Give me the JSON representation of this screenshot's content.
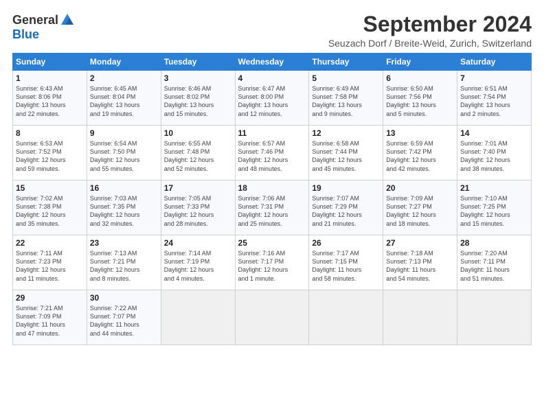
{
  "logo": {
    "general": "General",
    "blue": "Blue"
  },
  "title": "September 2024",
  "location": "Seuzach Dorf / Breite-Weid, Zurich, Switzerland",
  "days_header": [
    "Sunday",
    "Monday",
    "Tuesday",
    "Wednesday",
    "Thursday",
    "Friday",
    "Saturday"
  ],
  "weeks": [
    [
      {
        "day": "1",
        "lines": [
          "Sunrise: 6:43 AM",
          "Sunset: 8:06 PM",
          "Daylight: 13 hours",
          "and 22 minutes."
        ]
      },
      {
        "day": "2",
        "lines": [
          "Sunrise: 6:45 AM",
          "Sunset: 8:04 PM",
          "Daylight: 13 hours",
          "and 19 minutes."
        ]
      },
      {
        "day": "3",
        "lines": [
          "Sunrise: 6:46 AM",
          "Sunset: 8:02 PM",
          "Daylight: 13 hours",
          "and 15 minutes."
        ]
      },
      {
        "day": "4",
        "lines": [
          "Sunrise: 6:47 AM",
          "Sunset: 8:00 PM",
          "Daylight: 13 hours",
          "and 12 minutes."
        ]
      },
      {
        "day": "5",
        "lines": [
          "Sunrise: 6:49 AM",
          "Sunset: 7:58 PM",
          "Daylight: 13 hours",
          "and 9 minutes."
        ]
      },
      {
        "day": "6",
        "lines": [
          "Sunrise: 6:50 AM",
          "Sunset: 7:56 PM",
          "Daylight: 13 hours",
          "and 5 minutes."
        ]
      },
      {
        "day": "7",
        "lines": [
          "Sunrise: 6:51 AM",
          "Sunset: 7:54 PM",
          "Daylight: 13 hours",
          "and 2 minutes."
        ]
      }
    ],
    [
      {
        "day": "8",
        "lines": [
          "Sunrise: 6:53 AM",
          "Sunset: 7:52 PM",
          "Daylight: 12 hours",
          "and 59 minutes."
        ]
      },
      {
        "day": "9",
        "lines": [
          "Sunrise: 6:54 AM",
          "Sunset: 7:50 PM",
          "Daylight: 12 hours",
          "and 55 minutes."
        ]
      },
      {
        "day": "10",
        "lines": [
          "Sunrise: 6:55 AM",
          "Sunset: 7:48 PM",
          "Daylight: 12 hours",
          "and 52 minutes."
        ]
      },
      {
        "day": "11",
        "lines": [
          "Sunrise: 6:57 AM",
          "Sunset: 7:46 PM",
          "Daylight: 12 hours",
          "and 48 minutes."
        ]
      },
      {
        "day": "12",
        "lines": [
          "Sunrise: 6:58 AM",
          "Sunset: 7:44 PM",
          "Daylight: 12 hours",
          "and 45 minutes."
        ]
      },
      {
        "day": "13",
        "lines": [
          "Sunrise: 6:59 AM",
          "Sunset: 7:42 PM",
          "Daylight: 12 hours",
          "and 42 minutes."
        ]
      },
      {
        "day": "14",
        "lines": [
          "Sunrise: 7:01 AM",
          "Sunset: 7:40 PM",
          "Daylight: 12 hours",
          "and 38 minutes."
        ]
      }
    ],
    [
      {
        "day": "15",
        "lines": [
          "Sunrise: 7:02 AM",
          "Sunset: 7:38 PM",
          "Daylight: 12 hours",
          "and 35 minutes."
        ]
      },
      {
        "day": "16",
        "lines": [
          "Sunrise: 7:03 AM",
          "Sunset: 7:35 PM",
          "Daylight: 12 hours",
          "and 32 minutes."
        ]
      },
      {
        "day": "17",
        "lines": [
          "Sunrise: 7:05 AM",
          "Sunset: 7:33 PM",
          "Daylight: 12 hours",
          "and 28 minutes."
        ]
      },
      {
        "day": "18",
        "lines": [
          "Sunrise: 7:06 AM",
          "Sunset: 7:31 PM",
          "Daylight: 12 hours",
          "and 25 minutes."
        ]
      },
      {
        "day": "19",
        "lines": [
          "Sunrise: 7:07 AM",
          "Sunset: 7:29 PM",
          "Daylight: 12 hours",
          "and 21 minutes."
        ]
      },
      {
        "day": "20",
        "lines": [
          "Sunrise: 7:09 AM",
          "Sunset: 7:27 PM",
          "Daylight: 12 hours",
          "and 18 minutes."
        ]
      },
      {
        "day": "21",
        "lines": [
          "Sunrise: 7:10 AM",
          "Sunset: 7:25 PM",
          "Daylight: 12 hours",
          "and 15 minutes."
        ]
      }
    ],
    [
      {
        "day": "22",
        "lines": [
          "Sunrise: 7:11 AM",
          "Sunset: 7:23 PM",
          "Daylight: 12 hours",
          "and 11 minutes."
        ]
      },
      {
        "day": "23",
        "lines": [
          "Sunrise: 7:13 AM",
          "Sunset: 7:21 PM",
          "Daylight: 12 hours",
          "and 8 minutes."
        ]
      },
      {
        "day": "24",
        "lines": [
          "Sunrise: 7:14 AM",
          "Sunset: 7:19 PM",
          "Daylight: 12 hours",
          "and 4 minutes."
        ]
      },
      {
        "day": "25",
        "lines": [
          "Sunrise: 7:16 AM",
          "Sunset: 7:17 PM",
          "Daylight: 12 hours",
          "and 1 minute."
        ]
      },
      {
        "day": "26",
        "lines": [
          "Sunrise: 7:17 AM",
          "Sunset: 7:15 PM",
          "Daylight: 11 hours",
          "and 58 minutes."
        ]
      },
      {
        "day": "27",
        "lines": [
          "Sunrise: 7:18 AM",
          "Sunset: 7:13 PM",
          "Daylight: 11 hours",
          "and 54 minutes."
        ]
      },
      {
        "day": "28",
        "lines": [
          "Sunrise: 7:20 AM",
          "Sunset: 7:11 PM",
          "Daylight: 11 hours",
          "and 51 minutes."
        ]
      }
    ],
    [
      {
        "day": "29",
        "lines": [
          "Sunrise: 7:21 AM",
          "Sunset: 7:09 PM",
          "Daylight: 11 hours",
          "and 47 minutes."
        ]
      },
      {
        "day": "30",
        "lines": [
          "Sunrise: 7:22 AM",
          "Sunset: 7:07 PM",
          "Daylight: 11 hours",
          "and 44 minutes."
        ]
      },
      {
        "day": "",
        "lines": []
      },
      {
        "day": "",
        "lines": []
      },
      {
        "day": "",
        "lines": []
      },
      {
        "day": "",
        "lines": []
      },
      {
        "day": "",
        "lines": []
      }
    ]
  ]
}
